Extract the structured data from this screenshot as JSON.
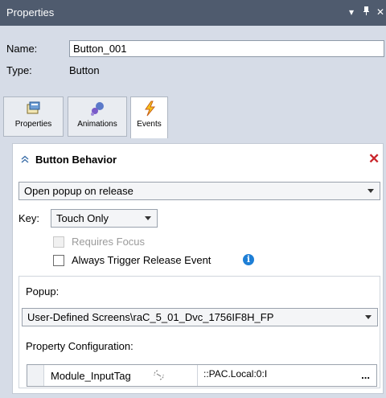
{
  "window": {
    "title": "Properties",
    "menu_glyph": "▾",
    "pin_glyph": "ᵖ",
    "close_glyph": "✕"
  },
  "object": {
    "name_label": "Name:",
    "name_value": "Button_001",
    "type_label": "Type:",
    "type_value": "Button"
  },
  "tabs": [
    {
      "label": "Properties",
      "icon": "properties-icon",
      "active": false
    },
    {
      "label": "Animations",
      "icon": "animations-icon",
      "active": false
    },
    {
      "label": "Events",
      "icon": "lightning-icon",
      "active": true
    }
  ],
  "section": {
    "title": "Button Behavior",
    "collapse_glyph": "⌃",
    "delete_glyph": "✕",
    "behavior_value": "Open popup on release",
    "key_label": "Key:",
    "key_value": "Touch Only",
    "requires_focus_label": "Requires Focus",
    "always_trigger_label": "Always Trigger Release Event",
    "info_glyph": "i"
  },
  "popup": {
    "label": "Popup:",
    "value": "User-Defined Screens\\raC_5_01_Dvc_1756IF8H_FP",
    "property_config_label": "Property Configuration:",
    "rows": [
      {
        "name": "Module_InputTag",
        "value": "::PAC.Local:0:I",
        "ellipsis": "..."
      }
    ]
  },
  "colors": {
    "titlebar": "#4f5b6e",
    "header_bg": "#d6dce7",
    "delete_red": "#c9252b",
    "info_blue": "#1e7fd6"
  }
}
